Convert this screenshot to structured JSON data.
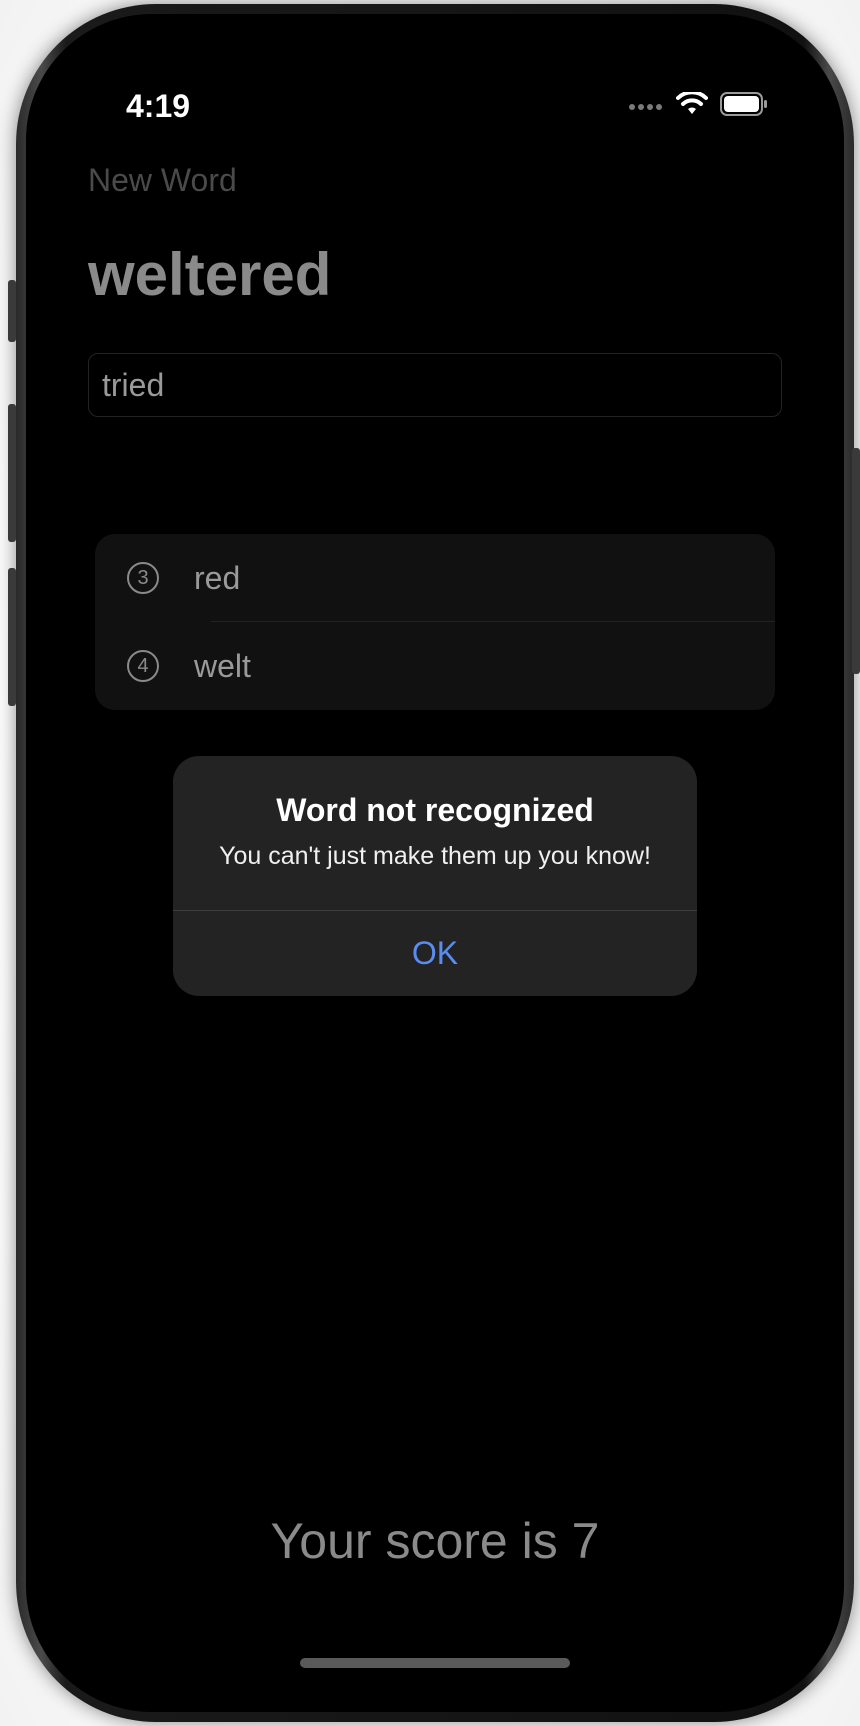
{
  "status_bar": {
    "time": "4:19",
    "icons": [
      "cellular-dots-icon",
      "wifi-icon",
      "battery-icon"
    ]
  },
  "nav": {
    "small_title": "New Word",
    "large_title": "weltered"
  },
  "input": {
    "value": "tried"
  },
  "words": [
    {
      "count": "3",
      "word": "red"
    },
    {
      "count": "4",
      "word": "welt"
    }
  ],
  "alert": {
    "title": "Word not recognized",
    "message": "You can't just make them up you know!",
    "ok_label": "OK"
  },
  "score": {
    "text": "Your score is 7"
  },
  "colors": {
    "background": "#000000",
    "accent": "#5b8cf2",
    "alert_bg": "#232323"
  }
}
